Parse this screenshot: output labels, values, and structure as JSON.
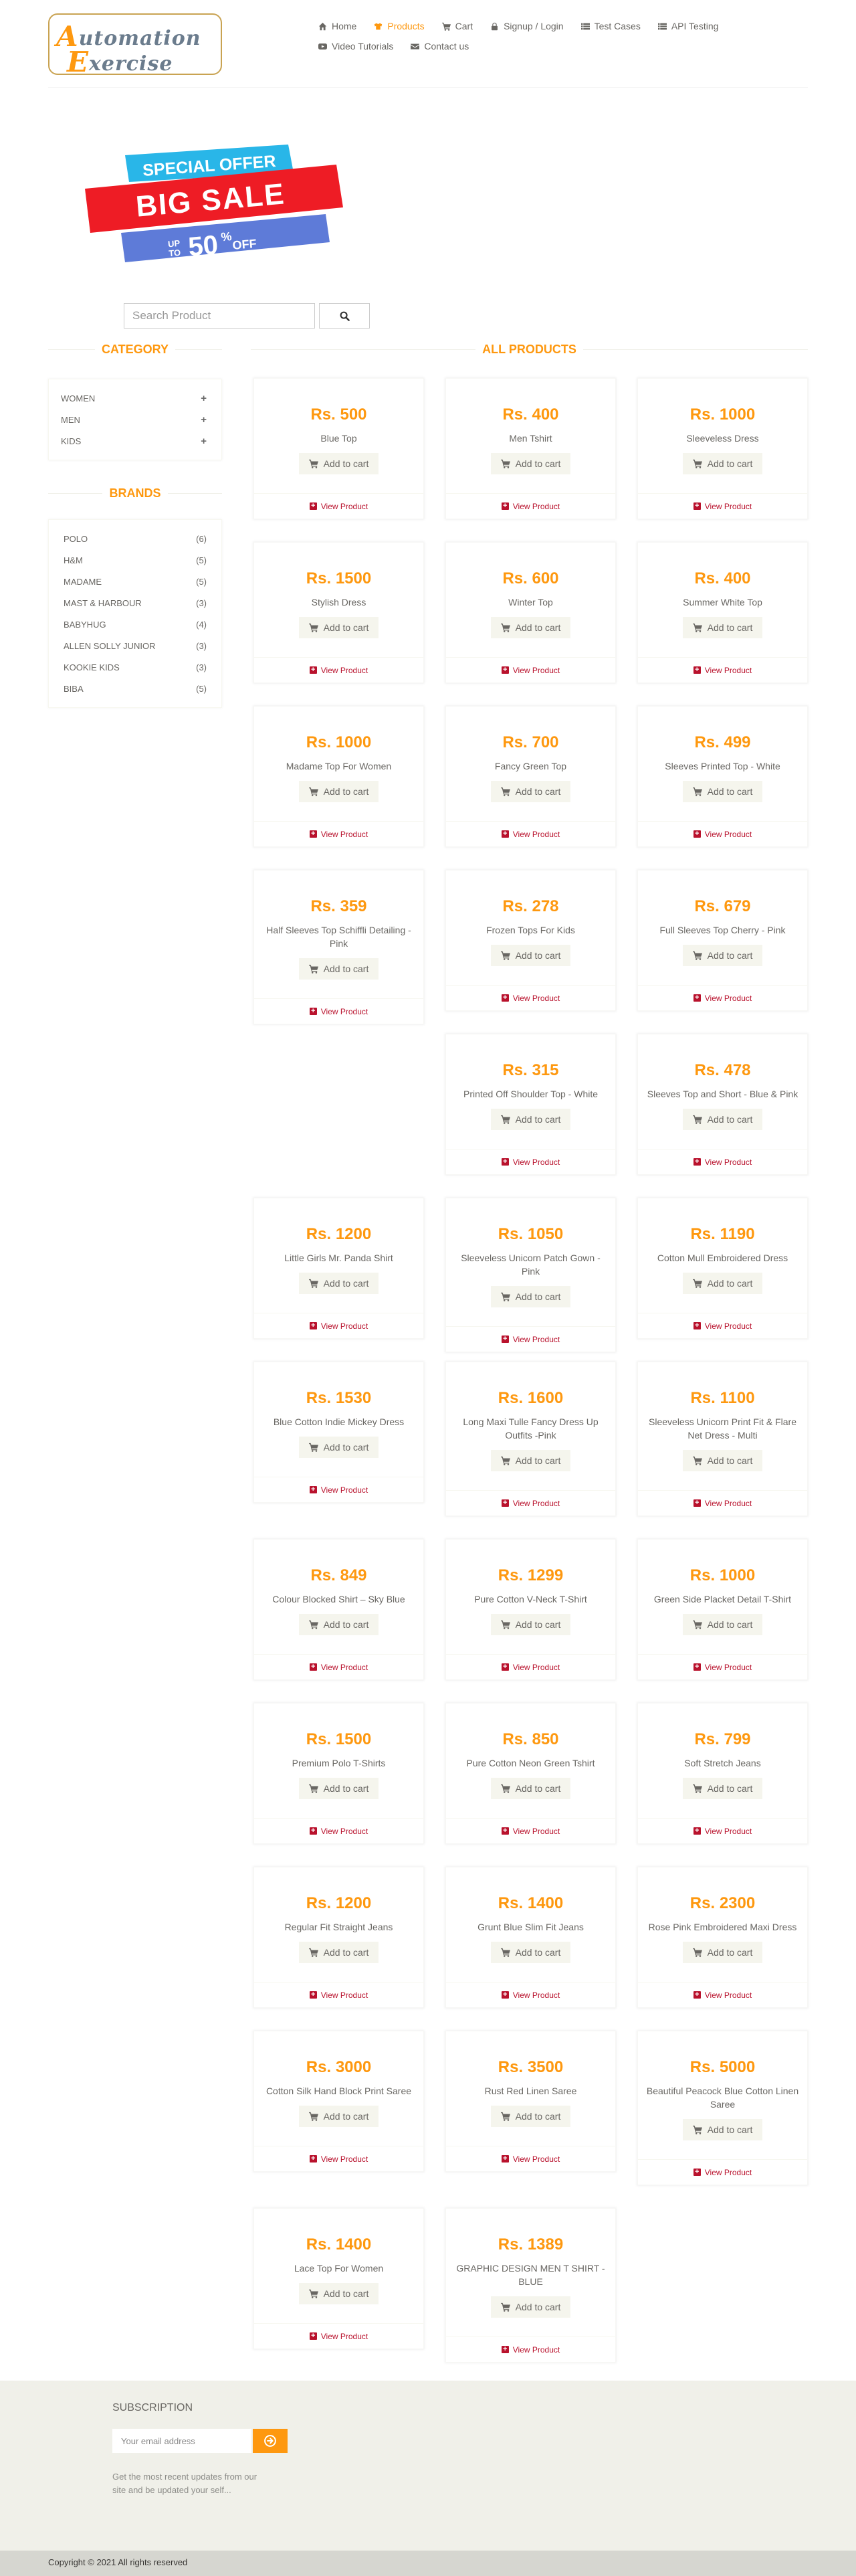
{
  "logo": {
    "line1": "Automation",
    "line2": "Exercise"
  },
  "nav": {
    "row1": [
      {
        "label": "Home",
        "icon": "home-icon"
      },
      {
        "label": "Products",
        "icon": "shirt-icon",
        "active": true
      },
      {
        "label": "Cart",
        "icon": "cart-icon"
      },
      {
        "label": "Signup / Login",
        "icon": "lock-icon"
      },
      {
        "label": "Test Cases",
        "icon": "list-icon"
      },
      {
        "label": "API Testing",
        "icon": "list-icon"
      }
    ],
    "row2": [
      {
        "label": "Video Tutorials",
        "icon": "youtube-icon"
      },
      {
        "label": "Contact us",
        "icon": "envelope-icon"
      }
    ]
  },
  "banner": {
    "line1": "SPECIAL OFFER",
    "line2": "BIG SALE",
    "line3a": "UP",
    "line3b": "TO",
    "line3c": "50",
    "line3d": "%",
    "line3e": "OFF"
  },
  "search": {
    "placeholder": "Search Product"
  },
  "sidebar": {
    "category_title": "CATEGORY",
    "categories": [
      {
        "label": "Women"
      },
      {
        "label": "Men"
      },
      {
        "label": "Kids"
      }
    ],
    "brands_title": "BRANDS",
    "brands": [
      {
        "name": "Polo",
        "count": "(6)"
      },
      {
        "name": "H&M",
        "count": "(5)"
      },
      {
        "name": "Madame",
        "count": "(5)"
      },
      {
        "name": "Mast & Harbour",
        "count": "(3)"
      },
      {
        "name": "Babyhug",
        "count": "(4)"
      },
      {
        "name": "Allen Solly Junior",
        "count": "(3)"
      },
      {
        "name": "Kookie Kids",
        "count": "(3)"
      },
      {
        "name": "Biba",
        "count": "(5)"
      }
    ]
  },
  "products": {
    "title": "ALL PRODUCTS",
    "add_label": "Add to cart",
    "view_label": "View Product",
    "items": [
      {
        "price": "Rs. 500",
        "name": "Blue Top"
      },
      {
        "price": "Rs. 400",
        "name": "Men Tshirt"
      },
      {
        "price": "Rs. 1000",
        "name": "Sleeveless Dress"
      },
      {
        "price": "Rs. 1500",
        "name": "Stylish Dress"
      },
      {
        "price": "Rs. 600",
        "name": "Winter Top"
      },
      {
        "price": "Rs. 400",
        "name": "Summer White Top"
      },
      {
        "price": "Rs. 1000",
        "name": "Madame Top For Women"
      },
      {
        "price": "Rs. 700",
        "name": "Fancy Green Top"
      },
      {
        "price": "Rs. 499",
        "name": "Sleeves Printed Top - White"
      },
      {
        "price": "Rs. 359",
        "name": "Half Sleeves Top Schiffli Detailing - Pink"
      },
      {
        "price": "Rs. 278",
        "name": "Frozen Tops For Kids"
      },
      {
        "price": "Rs. 679",
        "name": "Full Sleeves Top Cherry - Pink"
      },
      {
        "price": "Rs. 315",
        "name": "Printed Off Shoulder Top - White"
      },
      {
        "price": "Rs. 478",
        "name": "Sleeves Top and Short - Blue & Pink"
      },
      {
        "price": "Rs. 1200",
        "name": "Little Girls Mr. Panda Shirt"
      },
      {
        "price": "Rs. 1050",
        "name": "Sleeveless Unicorn Patch Gown - Pink"
      },
      {
        "price": "Rs. 1190",
        "name": "Cotton Mull Embroidered Dress"
      },
      {
        "price": "Rs. 1530",
        "name": "Blue Cotton Indie Mickey Dress"
      },
      {
        "price": "Rs. 1600",
        "name": "Long Maxi Tulle Fancy Dress Up Outfits -Pink"
      },
      {
        "price": "Rs. 1100",
        "name": "Sleeveless Unicorn Print Fit & Flare Net Dress - Multi"
      },
      {
        "price": "Rs. 849",
        "name": "Colour Blocked Shirt – Sky Blue"
      },
      {
        "price": "Rs. 1299",
        "name": "Pure Cotton V-Neck T-Shirt"
      },
      {
        "price": "Rs. 1000",
        "name": "Green Side Placket Detail T-Shirt"
      },
      {
        "price": "Rs. 1500",
        "name": "Premium Polo T-Shirts"
      },
      {
        "price": "Rs. 850",
        "name": "Pure Cotton Neon Green Tshirt"
      },
      {
        "price": "Rs. 799",
        "name": "Soft Stretch Jeans"
      },
      {
        "price": "Rs. 1200",
        "name": "Regular Fit Straight Jeans"
      },
      {
        "price": "Rs. 1400",
        "name": "Grunt Blue Slim Fit Jeans"
      },
      {
        "price": "Rs. 2300",
        "name": "Rose Pink Embroidered Maxi Dress"
      },
      {
        "price": "Rs. 3000",
        "name": "Cotton Silk Hand Block Print Saree"
      },
      {
        "price": "Rs. 3500",
        "name": "Rust Red Linen Saree"
      },
      {
        "price": "Rs. 5000",
        "name": "Beautiful Peacock Blue Cotton Linen Saree"
      },
      {
        "price": "Rs. 1400",
        "name": "Lace Top For Women"
      },
      {
        "price": "Rs. 1389",
        "name": "GRAPHIC DESIGN MEN T SHIRT - BLUE"
      }
    ]
  },
  "footer": {
    "subscription_title": "Subscription",
    "email_placeholder": "Your email address",
    "subscription_text": "Get the most recent updates from our site and be updated your self...",
    "copyright": "Copyright © 2021 All rights reserved"
  },
  "colors": {
    "accent": "#FE980F",
    "link_red": "#B9122D",
    "footer_bg": "#F0F0E9"
  }
}
